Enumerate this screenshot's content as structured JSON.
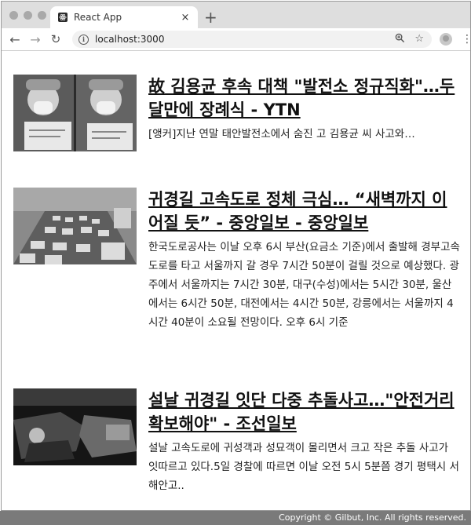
{
  "browser": {
    "tab_title": "React App",
    "tab_close": "×",
    "new_tab": "+",
    "url": "localhost:3000",
    "info_glyph": "i"
  },
  "articles": [
    {
      "title": "故 김용균 후속 대책 \"발전소 정규직화\"…두 달만에 장례식 - YTN",
      "description": "[앵커]지난 연말 태안발전소에서 숨진 고 김용균 씨 사고와…",
      "thumb_icon": "protest-photo"
    },
    {
      "title": "귀경길 고속도로 정체 극심… “새벽까지 이어질 듯” - 중앙일보 - 중앙일보",
      "description": "한국도로공사는 이날 오후 6시 부산(요금소 기준)에서 출발해 경부고속도로를 타고 서울까지 갈 경우 7시간 50분이 걸릴 것으로 예상했다. 광주에서 서울까지는 7시간 30분, 대구(수성)에서는 5시간 30분, 울산에서는 6시간 50분, 대전에서는 4시간 50분, 강릉에서는 서울까지 4시간 40분이 소요될 전망이다. 오후 6시 기준",
      "thumb_icon": "highway-traffic-photo"
    },
    {
      "title": "설날 귀경길 잇단 다중 추돌사고…\"안전거리 확보해야\" - 조선일보",
      "description": "설날 고속도로에 귀성객과 성묘객이 몰리면서 크고 작은 추돌 사고가 잇따르고 있다.5일 경찰에 따르면 이날 오전 5시 5분쯤 경기 평택시 서해안고..",
      "thumb_icon": "car-crash-photo"
    }
  ],
  "footer": {
    "copyright": "Copyright © Gilbut, Inc. All rights reserved."
  }
}
